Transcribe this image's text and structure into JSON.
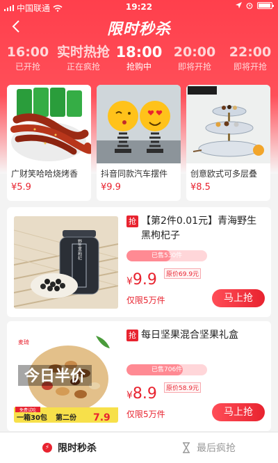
{
  "status_bar": {
    "carrier": "中国联通",
    "time": "19:22"
  },
  "nav": {
    "title": "限时秒杀",
    "back_icon": "chevron-left-icon"
  },
  "time_tabs": [
    {
      "time": "16:00",
      "status": "已开抢"
    },
    {
      "time": "实时热抢",
      "status": "正在疯抢"
    },
    {
      "time": "18:00",
      "status": "抢购中",
      "active": true
    },
    {
      "time": "20:00",
      "status": "即将开抢"
    },
    {
      "time": "22:00",
      "status": "即将开抢"
    }
  ],
  "featured": [
    {
      "title": "广财笑哈哈烧烤香",
      "price": "¥5.9"
    },
    {
      "title": "抖音同款汽车摆件",
      "price": "¥9.9"
    },
    {
      "title": "创意欧式可多层叠",
      "price": "¥8.5"
    }
  ],
  "products": [
    {
      "badge": "抢",
      "title": "【第2件0.01元】青海野生黑枸杞子",
      "sold": "已售530件",
      "sold_ratio": 0.55,
      "currency": "¥",
      "price": "9.9",
      "original": "原价69.9元",
      "limit": "仅限5万件",
      "button": "马上抢",
      "jar_label": "野生黑枸杞"
    },
    {
      "badge": "抢",
      "title": "每日坚果混合坚果礼盒",
      "sold": "已售706件",
      "sold_ratio": 0.7,
      "currency": "¥",
      "price": "8.9",
      "original": "原价58.9元",
      "limit": "仅限5万件",
      "button": "马上抢",
      "overlay_text": "今日半价",
      "brand": "麦琦",
      "promo_tag": "免费试吃",
      "promo_left": "一箱30包",
      "promo_right": "第二份",
      "promo_price": "7.9"
    }
  ],
  "bottom_tabs": [
    {
      "label": "限时秒杀",
      "active": true
    },
    {
      "label": "最后疯抢"
    }
  ],
  "colors": {
    "accent": "#e8232f",
    "header": "#ff3f4c"
  }
}
